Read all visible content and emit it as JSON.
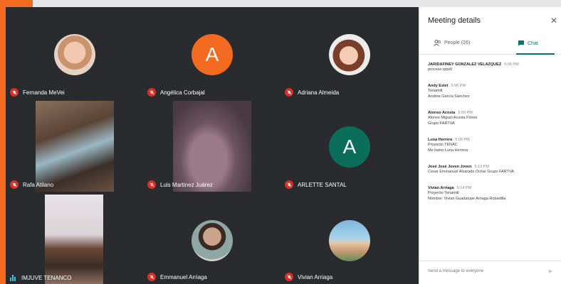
{
  "participants": [
    {
      "name": "Fernanda MeVei",
      "type": "photo",
      "mic": "muted"
    },
    {
      "name": "Angélica Corbajal",
      "type": "letter",
      "letter": "A",
      "color": "#f26b21",
      "mic": "muted"
    },
    {
      "name": "Adriana Almeida",
      "type": "photo",
      "mic": "muted"
    },
    {
      "name": "Rafa Atilano",
      "type": "video",
      "mic": "muted"
    },
    {
      "name": "Luis Martinez Juárez",
      "type": "video",
      "mic": "muted"
    },
    {
      "name": "ARLETTE SANTAL",
      "type": "letter",
      "letter": "A",
      "color": "#0b6e5a",
      "mic": "muted"
    },
    {
      "name": "IMJUVE TENANCO",
      "type": "video",
      "mic": "speaking"
    },
    {
      "name": "Emmanuel Arriaga",
      "type": "photo",
      "mic": "muted"
    },
    {
      "name": "Vivian Arriaga",
      "type": "photo",
      "mic": "muted"
    }
  ],
  "panel": {
    "title": "Meeting details",
    "people_tab": "People (26)",
    "chat_tab": "Chat",
    "compose_placeholder": "Send a message to everyone"
  },
  "messages": [
    {
      "sender": "JARIDAFINEY GONZALEZ VELAZQUEZ",
      "time": "5:06 PM",
      "lines": [
        "proceso ippidi"
      ]
    },
    {
      "sender": "Andy Eslet",
      "time": "5:06 PM",
      "lines": [
        "Tenamitl",
        "Andrea García Sánchez"
      ]
    },
    {
      "sender": "Alonso Acosta",
      "time": "5:09 PM",
      "lines": [
        "Alonso Miguel Acosta Flores",
        "Grupo FARTVA"
      ]
    },
    {
      "sender": "Luna Herrera",
      "time": "5:09 PM",
      "lines": [
        "Proyecto TENAC",
        "Me llamo Luna Herrera"
      ]
    },
    {
      "sender": "José José Joven Joven",
      "time": "5:13 PM",
      "lines": [
        "Cesar Emmanuel Alvarado Ocitar Grupo FARTVA"
      ]
    },
    {
      "sender": "Vivian Arriaga",
      "time": "5:14 PM",
      "lines": [
        "Proyecto Tenamitl",
        "Nombre: Vivian Guadalupe Arriaga Robadilla"
      ]
    }
  ]
}
